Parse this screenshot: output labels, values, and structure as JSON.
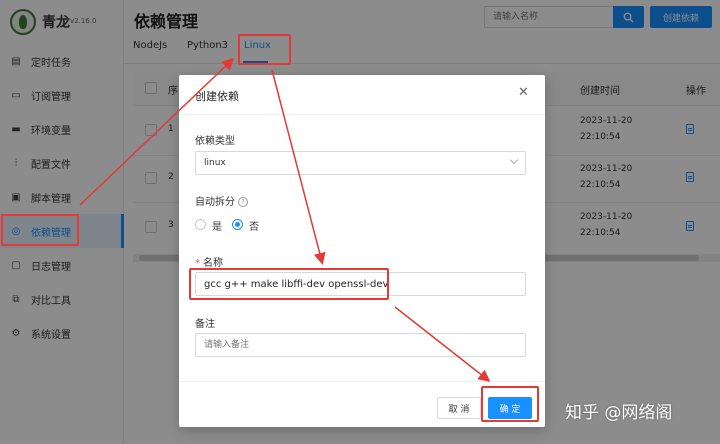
{
  "app": {
    "name": "青龙",
    "version": "v2.16.0"
  },
  "sidebar": {
    "items": [
      {
        "label": "定时任务",
        "icon": "calendar-icon"
      },
      {
        "label": "订阅管理",
        "icon": "subscription-icon"
      },
      {
        "label": "环境变量",
        "icon": "monitor-icon"
      },
      {
        "label": "配置文件",
        "icon": "sliders-icon"
      },
      {
        "label": "脚本管理",
        "icon": "script-icon"
      },
      {
        "label": "依赖管理",
        "icon": "dependency-icon",
        "active": true
      },
      {
        "label": "日志管理",
        "icon": "log-icon"
      },
      {
        "label": "对比工具",
        "icon": "diff-icon"
      },
      {
        "label": "系统设置",
        "icon": "gear-icon"
      }
    ]
  },
  "header": {
    "title": "依赖管理",
    "search_placeholder": "请输入名称",
    "create_label": "创建依赖"
  },
  "tabs": [
    {
      "label": "NodeJs"
    },
    {
      "label": "Python3"
    },
    {
      "label": "Linux",
      "active": true
    }
  ],
  "table": {
    "headers": {
      "index": "序",
      "created": "创建时间",
      "actions": "操作"
    },
    "rows": [
      {
        "index": "1",
        "created_date": "2023-11-20",
        "created_time": "22:10:54"
      },
      {
        "index": "2",
        "created_date": "2023-11-20",
        "created_time": "22:10:54"
      },
      {
        "index": "3",
        "created_date": "2023-11-20",
        "created_time": "22:10:54"
      }
    ]
  },
  "modal": {
    "title": "创建依赖",
    "type_label": "依赖类型",
    "type_value": "linux",
    "split_label": "自动拆分",
    "split_options": {
      "yes": "是",
      "no": "否",
      "selected": "no"
    },
    "name_label": "名称",
    "name_value": "gcc g++ make libffi-dev openssl-dev",
    "note_label": "备注",
    "note_placeholder": "请输入备注",
    "cancel_label": "取 消",
    "ok_label": "确 定"
  },
  "watermark": "知乎 @网络阁",
  "colors": {
    "accent": "#1890ff",
    "annotation": "#e53935"
  }
}
